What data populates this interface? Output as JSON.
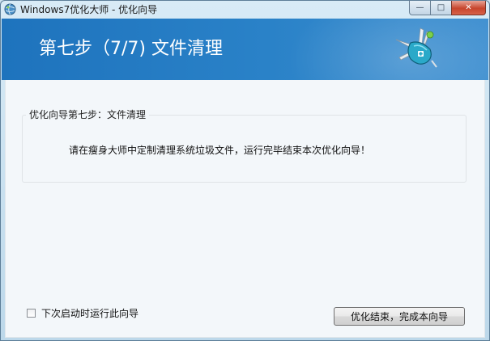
{
  "window": {
    "title": "Windows7优化大师 - 优化向导",
    "controls": {
      "minimize": "—",
      "maximize": "□",
      "close": "✕"
    }
  },
  "banner": {
    "title": "第七步（7/7) 文件清理",
    "logo_icon": "swiss-army-knife-icon"
  },
  "group": {
    "legend": "优化向导第七步：文件清理",
    "message": "请在瘦身大师中定制清理系统垃圾文件，运行完毕结束本次优化向导！"
  },
  "footer": {
    "checkbox_label": "下次启动时运行此向导",
    "checkbox_checked": false,
    "finish_button": "优化结束，完成本向导"
  },
  "colors": {
    "banner_blue": "#2a82c8",
    "content_bg": "#f3f7fa",
    "close_red": "#c7462d"
  }
}
